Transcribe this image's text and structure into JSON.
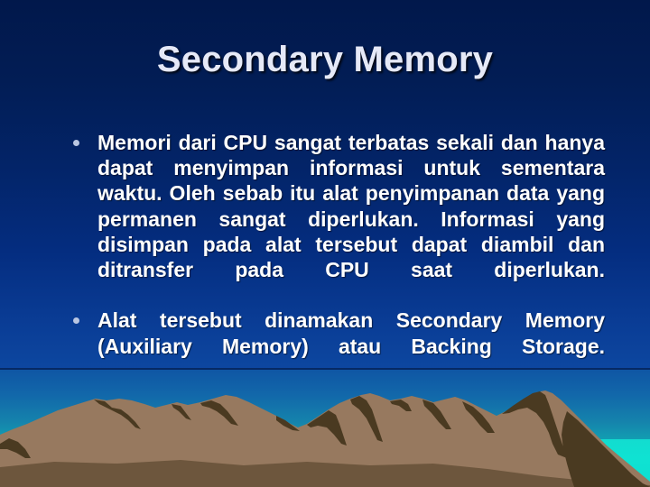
{
  "slide": {
    "title": "Secondary Memory",
    "bullets": [
      {
        "marker": "bullet-dot",
        "text": "Memori dari CPU sangat terbatas sekali dan hanya dapat menyimpan informasi untuk sementara waktu. Oleh sebab itu alat penyimpanan data yang permanen sangat diperlukan. Informasi yang disimpan pada alat tersebut dapat diambil dan ditransfer pada CPU saat diperlukan."
      },
      {
        "marker": "bullet-dot",
        "text": "Alat tersebut dinamakan Secondary Memory (Auxiliary Memory) atau Backing Storage."
      }
    ],
    "graphic": {
      "name": "mountain-range-silhouette",
      "sky_top_color": "#01184b",
      "sky_bottom_color": "#0fe0cf",
      "mountain_light_color": "#97795f",
      "mountain_shadow_color": "#4a3a21",
      "sea_color": "#11e0d0"
    },
    "colors": {
      "title_text": "#e6e9f7",
      "body_text": "#ffffff",
      "bullet_dot": "#b9c6e2",
      "background_navy": "#032468",
      "background_blue": "#0d47a0"
    }
  }
}
